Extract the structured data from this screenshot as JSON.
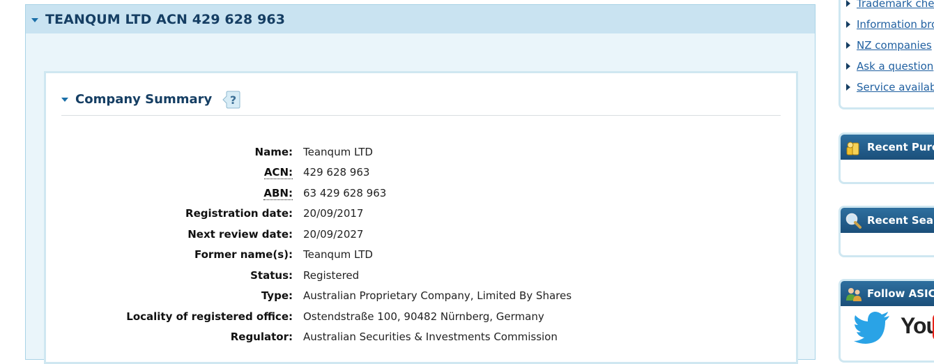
{
  "main": {
    "title": "TEANQUM LTD ACN 429 628 963"
  },
  "summary": {
    "title": "Company Summary",
    "rows": [
      {
        "label": "Name:",
        "value": "Teanqum LTD"
      },
      {
        "label": "ACN:",
        "value": "429 628 963"
      },
      {
        "label": "ABN:",
        "value": "63 429 628 963"
      },
      {
        "label": "Registration date:",
        "value": "20/09/2017"
      },
      {
        "label": "Next review date:",
        "value": "20/09/2027"
      },
      {
        "label": "Former name(s):",
        "value": "Teanqum LTD"
      },
      {
        "label": "Status:",
        "value": "Registered"
      },
      {
        "label": "Type:",
        "value": "Australian Proprietary Company, Limited By Shares"
      },
      {
        "label": "Locality of registered office:",
        "value": "Ostendstraße 100, 90482 Nürnberg, Germany"
      },
      {
        "label": "Regulator:",
        "value": "Australian Securities & Investments Commission"
      }
    ]
  },
  "sidebar": {
    "links": [
      {
        "label": "Trademark che"
      },
      {
        "label": "Information bro"
      },
      {
        "label": "NZ companies"
      },
      {
        "label": "Ask a question"
      },
      {
        "label": "Service availabi"
      }
    ],
    "widgets": {
      "recent_purchases": "Recent Purch",
      "recent_searches": "Recent Searc",
      "follow": "Follow ASIC",
      "youtube_text": "You"
    }
  },
  "colors": {
    "accent": "#153e63",
    "link": "#1f5fa0",
    "panel": "#eaf5fa",
    "header": "#c9e3f1"
  }
}
